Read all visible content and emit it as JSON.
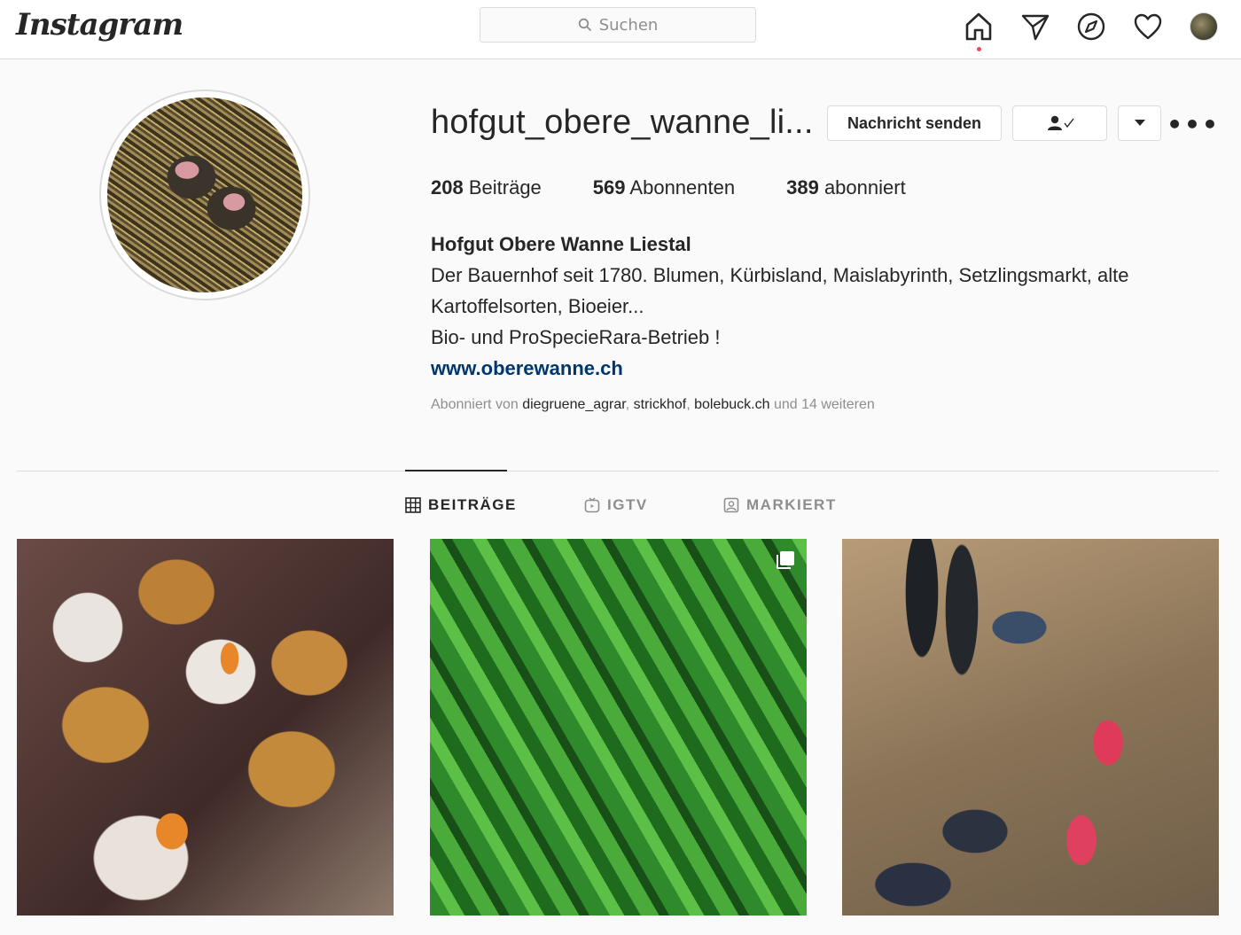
{
  "nav": {
    "logo": "Instagram",
    "search_placeholder": "Suchen",
    "icons": [
      "home-icon",
      "direct-icon",
      "explore-icon",
      "activity-heart-icon",
      "profile-avatar"
    ]
  },
  "profile": {
    "username": "hofgut_obere_wanne_li...",
    "buttons": {
      "message": "Nachricht senden",
      "follow_status_icon": "following-person-check-icon",
      "dropdown_icon": "caret-down-icon",
      "more": "•••"
    },
    "stats": [
      {
        "count": "208",
        "label": "Beiträge"
      },
      {
        "count": "569",
        "label": "Abonnenten"
      },
      {
        "count": "389",
        "label": "abonniert"
      }
    ],
    "bio": {
      "full_name": "Hofgut Obere Wanne Liestal",
      "line1": "Der Bauernhof seit 1780. Blumen, Kürbisland, Maislabyrinth, Setzlingsmarkt, alte",
      "line2": "Kartoffelsorten, Bioeier...",
      "line3": "Bio- und ProSpecieRara-Betrieb !",
      "website": "www.oberewanne.ch"
    },
    "followed_by": {
      "prefix": "Abonniert von",
      "accounts": [
        "diegruene_agrar",
        "strickhof",
        "bolebuck.ch"
      ],
      "suffix": "und 14 weiteren"
    }
  },
  "tabs": [
    {
      "label": "BEITRÄGE",
      "icon": "grid-icon",
      "active": true
    },
    {
      "label": "IGTV",
      "icon": "igtv-icon",
      "active": false
    },
    {
      "label": "MARKIERT",
      "icon": "tagged-icon",
      "active": false
    }
  ],
  "posts": [
    {
      "subject": "carrot cake muffins",
      "multi": false
    },
    {
      "subject": "cucumbers",
      "multi": true
    },
    {
      "subject": "boots and shoes",
      "multi": false
    }
  ],
  "colors": {
    "background": "#fafafa",
    "border": "#dbdbdb",
    "text": "#262626",
    "muted": "#8e8e8e",
    "link": "#00376b",
    "notification_dot": "#ed4956"
  }
}
